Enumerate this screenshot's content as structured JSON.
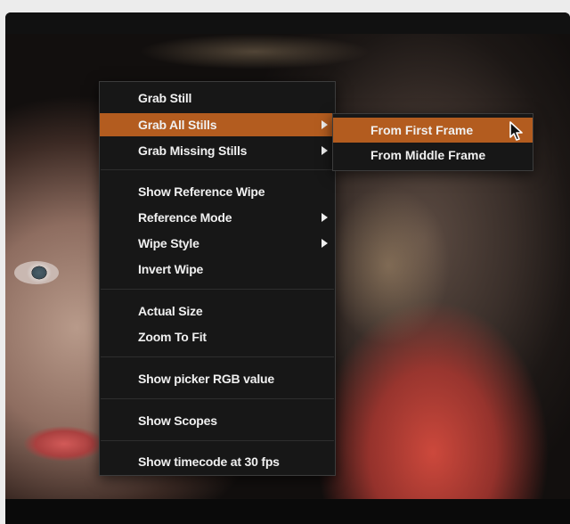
{
  "context_menu": {
    "items": [
      {
        "label": "Grab Still"
      },
      {
        "label": "Grab All Stills",
        "has_submenu": true,
        "highlighted": true
      },
      {
        "label": "Grab Missing Stills",
        "has_submenu": true
      },
      {
        "label": "Show Reference Wipe"
      },
      {
        "label": "Reference Mode",
        "has_submenu": true
      },
      {
        "label": "Wipe Style",
        "has_submenu": true
      },
      {
        "label": "Invert Wipe"
      },
      {
        "label": "Actual Size"
      },
      {
        "label": "Zoom To Fit"
      },
      {
        "label": "Show picker RGB value"
      },
      {
        "label": "Show Scopes"
      },
      {
        "label": "Show timecode at 30 fps"
      }
    ]
  },
  "submenu": {
    "items": [
      {
        "label": "From First Frame",
        "highlighted": true
      },
      {
        "label": "From Middle Frame"
      }
    ]
  },
  "colors": {
    "highlight": "#b35c1f",
    "menu_background": "#171717",
    "menu_text": "#f0f0f0"
  },
  "icons": {
    "submenu_arrow": "triangle-right-icon",
    "cursor": "arrow-cursor-icon"
  }
}
